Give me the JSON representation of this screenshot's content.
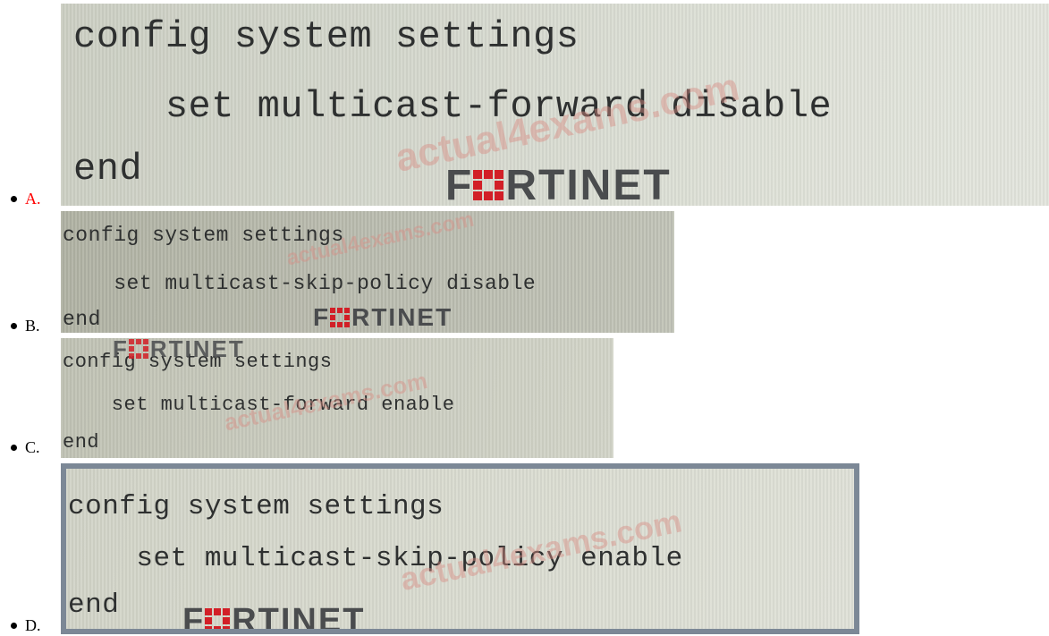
{
  "options": [
    {
      "letter": "A.",
      "lines": [
        "config system settings",
        "    set multicast-forward disable",
        "end"
      ],
      "watermark": "actual4exams.com",
      "logo_left": "F",
      "logo_right": "RTINET"
    },
    {
      "letter": "B.",
      "lines": [
        "config system settings",
        "    set multicast-skip-policy disable",
        "end"
      ],
      "watermark": "actual4exams.com",
      "logo_left": "F",
      "logo_right": "RTINET"
    },
    {
      "letter": "C.",
      "lines": [
        "config system settings",
        "    set multicast-forward enable",
        "end"
      ],
      "watermark": "actual4exams.com",
      "logo_left": "F",
      "logo_right": "RTINET"
    },
    {
      "letter": "D.",
      "lines": [
        "config system settings",
        "    set multicast-skip-policy enable",
        "end"
      ],
      "watermark": "actual4exams.com",
      "logo_left": "F",
      "logo_right": "RTINET"
    }
  ],
  "colors": {
    "selected_letter": "#ff0000",
    "logo_red": "#d21f27",
    "frame_d": "#7c8896"
  },
  "icons": {
    "bullet": "bullet-dot-icon",
    "logo_mark": "fortinet-grid-icon"
  }
}
